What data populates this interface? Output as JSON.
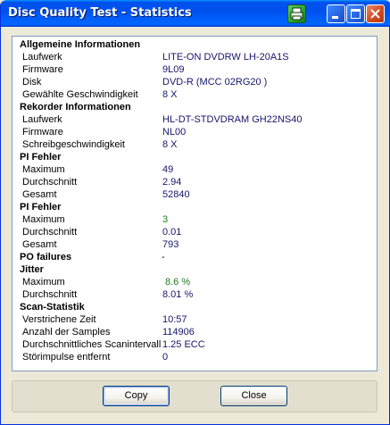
{
  "window": {
    "title": "Disc Quality Test - Statistics"
  },
  "sections": {
    "general": {
      "heading": "Allgemeine Informationen",
      "rows": [
        {
          "label": "Laufwerk",
          "value": "LITE-ON DVDRW LH-20A1S"
        },
        {
          "label": "Firmware",
          "value": "9L09"
        },
        {
          "label": "Disk",
          "value": "DVD-R (MCC 02RG20  )"
        },
        {
          "label": "Gewählte Geschwindigkeit",
          "value": "8 X"
        }
      ]
    },
    "recorder": {
      "heading": "Rekorder Informationen",
      "rows": [
        {
          "label": "Laufwerk",
          "value": "HL-DT-STDVDRAM GH22NS40"
        },
        {
          "label": "Firmware",
          "value": "NL00"
        },
        {
          "label": "Schreibgeschwindigkeit",
          "value": "8 X"
        }
      ]
    },
    "pi_errors": {
      "heading": "PI Fehler",
      "rows": [
        {
          "label": "Maximum",
          "value": "49"
        },
        {
          "label": "Durchschnitt",
          "value": "2.94"
        },
        {
          "label": "Gesamt",
          "value": "52840"
        }
      ]
    },
    "pi_failures": {
      "heading": "PI Fehler",
      "rows": [
        {
          "label": "Maximum",
          "value": "3"
        },
        {
          "label": "Durchschnitt",
          "value": "0.01"
        },
        {
          "label": "Gesamt",
          "value": "793"
        }
      ]
    },
    "po_failures": {
      "heading": "PO failures",
      "value": "-"
    },
    "jitter": {
      "heading": "Jitter",
      "rows": [
        {
          "label": "Maximum",
          "value": "8.6 %"
        },
        {
          "label": "Durchschnitt",
          "value": "8.01 %"
        }
      ]
    },
    "scan": {
      "heading": "Scan-Statistik",
      "rows": [
        {
          "label": "Verstrichene Zeit",
          "value": "10:57"
        },
        {
          "label": "Anzahl der Samples",
          "value": "114906"
        },
        {
          "label": "Durchschnittliches Scanintervall",
          "value": "1.25 ECC"
        },
        {
          "label": "Störimpulse entfernt",
          "value": "0"
        }
      ]
    }
  },
  "buttons": {
    "copy": "Copy",
    "close": "Close"
  },
  "colors": {
    "value_text": "#17156a",
    "value_green": "#1e7a1e",
    "titlebar": "#0053ee"
  },
  "icons": {
    "print": "printer-icon",
    "minimize": "minimize-icon",
    "maximize": "maximize-icon",
    "close": "close-icon"
  }
}
